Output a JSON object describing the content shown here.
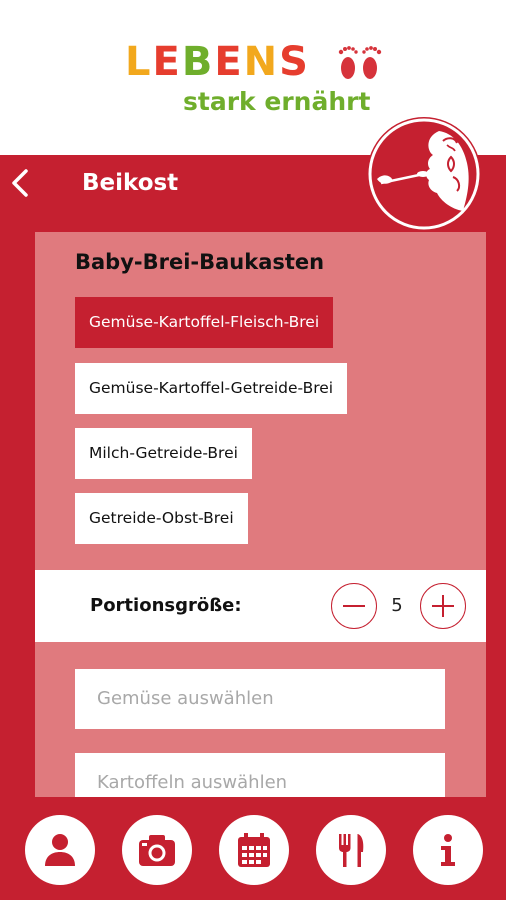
{
  "colors": {
    "brand_red": "#c52030",
    "panel_pink": "#e07a7e",
    "white": "#ffffff"
  },
  "logo": {
    "word": "LEBENS",
    "tagline": "stark ernährt",
    "letter_colors": [
      "#f2a81d",
      "#e63d2e",
      "#6fae2c",
      "#e63d2e",
      "#f2a81d",
      "#e63d2e"
    ],
    "tagline_color": "#6fae2c",
    "feet_color": "#d6333b"
  },
  "header": {
    "back_icon": "chevron-left-icon",
    "title": "Beikost",
    "illustration": "baby-spoon-feeding-icon"
  },
  "builder": {
    "title": "Baby-Brei-Baukasten",
    "options": [
      {
        "label": "Gemüse-Kartoffel-Fleisch-Brei",
        "selected": true
      },
      {
        "label": "Gemüse-Kartoffel-Getreide-Brei",
        "selected": false
      },
      {
        "label": "Milch-Getreide-Brei",
        "selected": false
      },
      {
        "label": "Getreide-Obst-Brei",
        "selected": false
      }
    ],
    "portion": {
      "label": "Portionsgröße:",
      "value": "5",
      "minus_icon": "minus-circle-icon",
      "plus_icon": "plus-circle-icon"
    },
    "selects": [
      {
        "placeholder": "Gemüse auswählen"
      },
      {
        "placeholder": "Kartoffeln auswählen"
      }
    ]
  },
  "bottom_nav": {
    "items": [
      {
        "icon": "user-icon"
      },
      {
        "icon": "camera-icon"
      },
      {
        "icon": "calendar-icon"
      },
      {
        "icon": "fork-knife-icon"
      },
      {
        "icon": "info-icon"
      }
    ]
  }
}
